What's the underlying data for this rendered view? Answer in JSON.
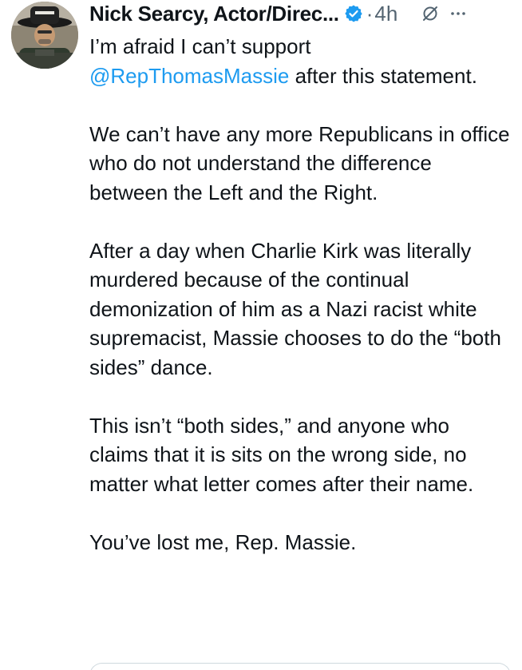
{
  "tweet": {
    "author_name": "Nick Searcy, Actor/Direc...",
    "separator": "·",
    "time": "4h",
    "verified_color": "#1d9bf0",
    "mention_color": "#1d9bf0",
    "icons": {
      "avatar": "avatar",
      "verified": "verified-badge-icon",
      "grok": "grok-icon",
      "more": "more-icon"
    },
    "paragraph_1_before": "I’m afraid I can’t support ",
    "mention": "@RepThomasMassie",
    "paragraph_1_after": " after this statement.",
    "paragraph_2": "We can’t have any more Republicans in office who do not understand the difference between the Left and the Right.",
    "paragraph_3": "After a day when Charlie Kirk was literally murdered because of the continual demonization of him as a Nazi racist white supremacist, Massie chooses to do the “both sides” dance.",
    "paragraph_4": "This isn’t “both sides,” and anyone who claims that it is sits on the wrong side, no matter what letter comes after their name.",
    "paragraph_5": "You’ve lost me, Rep. Massie."
  }
}
